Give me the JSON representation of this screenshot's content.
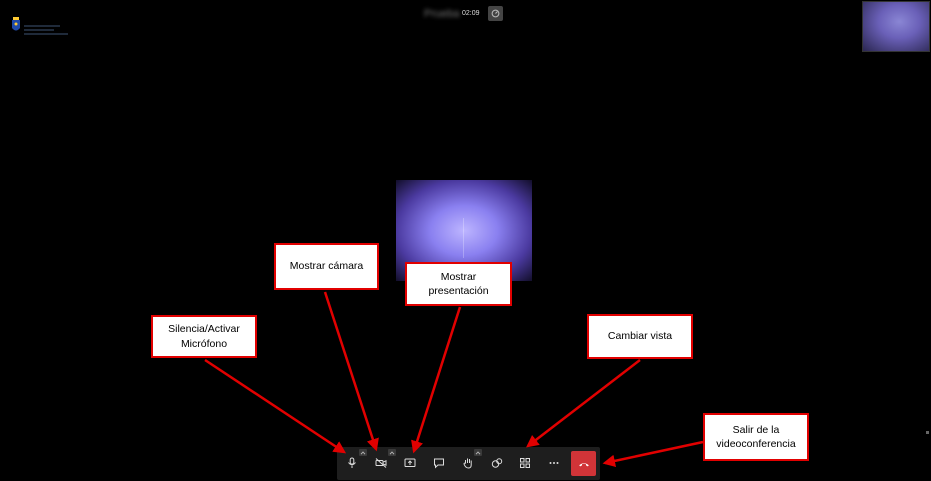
{
  "meeting": {
    "name": "Prueba",
    "timer": "02:09"
  },
  "logo": {
    "org": "Gobierno de Canarias"
  },
  "toolbar": {
    "buttons": [
      {
        "name": "microphone",
        "icon": "microphone-icon",
        "has_caret": true
      },
      {
        "name": "camera",
        "icon": "camera-off-icon",
        "has_caret": true
      },
      {
        "name": "share",
        "icon": "share-screen-icon",
        "has_caret": false
      },
      {
        "name": "chat",
        "icon": "chat-icon",
        "has_caret": false
      },
      {
        "name": "raise-hand",
        "icon": "raise-hand-icon",
        "has_caret": true
      },
      {
        "name": "reactions",
        "icon": "reactions-icon",
        "has_caret": false
      },
      {
        "name": "view",
        "icon": "grid-view-icon",
        "has_caret": false
      },
      {
        "name": "more",
        "icon": "more-options-icon",
        "has_caret": false
      },
      {
        "name": "hangup",
        "icon": "phone-hangup-icon",
        "has_caret": false
      }
    ]
  },
  "callouts": {
    "mute": "Silencia/Activar\nMicrófono",
    "camera": "Mostrar cámara",
    "present": "Mostrar\npresentación",
    "view": "Cambiar vista",
    "leave": "Salir de la\nvideoconferencia"
  },
  "colors": {
    "background": "#000000",
    "callout_border": "#e10000",
    "arrow": "#e10000",
    "hangup": "#d13438",
    "toolbar": "#1e1e1e"
  }
}
